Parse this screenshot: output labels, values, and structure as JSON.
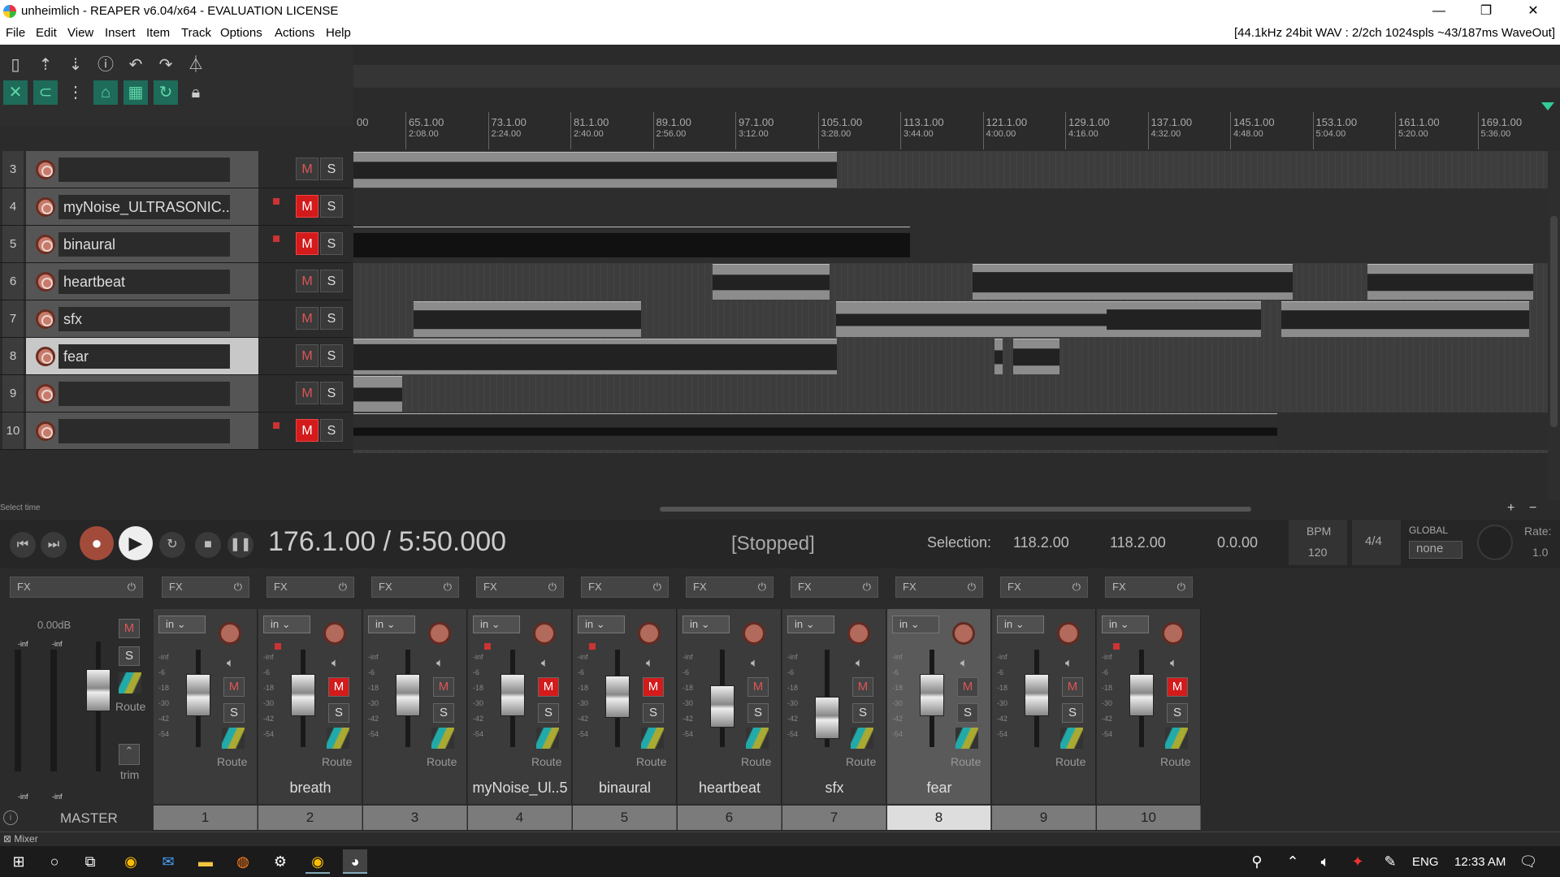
{
  "window": {
    "title": "unheimlich - REAPER v6.04/x64 - EVALUATION LICENSE",
    "minimize": "—",
    "maximize": "❐",
    "close": "✕"
  },
  "menu": [
    "File",
    "Edit",
    "View",
    "Insert",
    "Item",
    "Track",
    "Options",
    "Actions",
    "Help"
  ],
  "device_info": "[44.1kHz 24bit WAV : 2/2ch 1024spls ~43/187ms WaveOut]",
  "ruler": {
    "bars": [
      "65.1.00",
      "73.1.00",
      "81.1.00",
      "89.1.00",
      "97.1.00",
      "105.1.00",
      "113.1.00",
      "121.1.00",
      "129.1.00",
      "137.1.00",
      "145.1.00",
      "153.1.00",
      "161.1.00",
      "169.1.00"
    ],
    "times": [
      "2:08.00",
      "2:24.00",
      "2:40.00",
      "2:56.00",
      "3:12.00",
      "3:28.00",
      "3:44.00",
      "4:00.00",
      "4:16.00",
      "4:32.00",
      "4:48.00",
      "5:04.00",
      "5:20.00",
      "5:36.00"
    ],
    "first_partial": "00"
  },
  "tracks": [
    {
      "num": "3",
      "name": "",
      "mute": false,
      "fx_marker": false
    },
    {
      "num": "4",
      "name": "myNoise_ULTRASONIC..5",
      "mute": true,
      "fx_marker": true
    },
    {
      "num": "5",
      "name": "binaural",
      "mute": true,
      "fx_marker": true
    },
    {
      "num": "6",
      "name": "heartbeat",
      "mute": false,
      "fx_marker": false
    },
    {
      "num": "7",
      "name": "sfx",
      "mute": false,
      "fx_marker": false
    },
    {
      "num": "8",
      "name": "fear",
      "mute": false,
      "fx_marker": false,
      "selected": true
    },
    {
      "num": "9",
      "name": "",
      "mute": false,
      "fx_marker": false
    },
    {
      "num": "10",
      "name": "",
      "mute": true,
      "fx_marker": true
    }
  ],
  "labels": {
    "mute": "M",
    "solo": "S",
    "fx": "FX",
    "in": "in",
    "route": "Route",
    "trim": "trim",
    "master": "MASTER",
    "mixer_tab": "Mixer",
    "select_time": "Select time"
  },
  "transport": {
    "position": "176.1.00 / 5:50.000",
    "state": "[Stopped]",
    "selection_label": "Selection:",
    "sel_start": "118.2.00",
    "sel_end": "118.2.00",
    "sel_len": "0.0.00",
    "bpm_label": "BPM",
    "bpm": "120",
    "timesig": "4/4",
    "global_label": "GLOBAL",
    "global_value": "none",
    "rate_label": "Rate:",
    "rate": "1.0"
  },
  "master": {
    "volume": "0.00dB",
    "peak_l": "-inf",
    "peak_r": "-inf",
    "peak_l_bottom": "-inf",
    "peak_r_bottom": "-inf"
  },
  "mixer_strips": [
    {
      "num": "1",
      "name": "",
      "mute": false
    },
    {
      "num": "2",
      "name": "breath",
      "mute": true
    },
    {
      "num": "3",
      "name": "",
      "mute": false
    },
    {
      "num": "4",
      "name": "myNoise_Ul..5",
      "mute": true
    },
    {
      "num": "5",
      "name": "binaural",
      "mute": true
    },
    {
      "num": "6",
      "name": "heartbeat",
      "mute": false
    },
    {
      "num": "7",
      "name": "sfx",
      "mute": false
    },
    {
      "num": "8",
      "name": "fear",
      "mute": false,
      "selected": true
    },
    {
      "num": "9",
      "name": "",
      "mute": false
    },
    {
      "num": "10",
      "name": "",
      "mute": true
    }
  ],
  "taskbar": {
    "lang": "ENG",
    "time": "12:33 AM"
  },
  "colors": {
    "mute_on": "#d31b1b",
    "selected_track": "#c8c8c8",
    "envelope": "#c23b3b"
  }
}
